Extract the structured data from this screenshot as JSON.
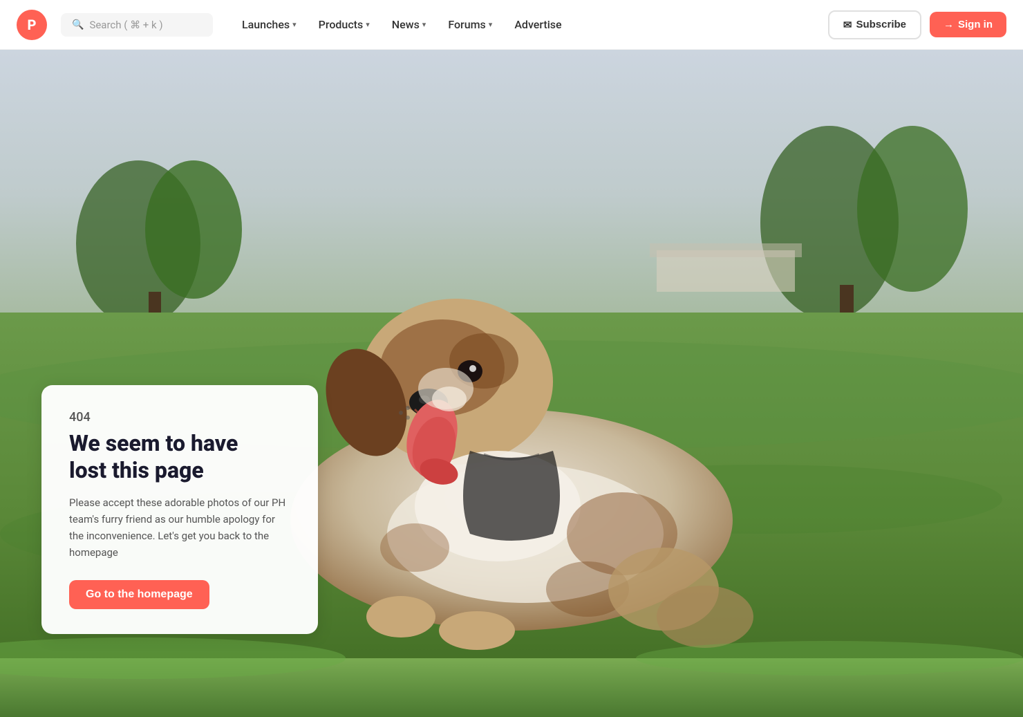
{
  "navbar": {
    "logo_letter": "P",
    "search_placeholder": "Search ( ⌘ + k )",
    "nav_items": [
      {
        "label": "Launches",
        "has_chevron": true
      },
      {
        "label": "Products",
        "has_chevron": true
      },
      {
        "label": "News",
        "has_chevron": true
      },
      {
        "label": "Forums",
        "has_chevron": true
      },
      {
        "label": "Advertise",
        "has_chevron": false
      }
    ],
    "subscribe_label": "Subscribe",
    "signin_label": "Sign in"
  },
  "error_page": {
    "error_code": "404",
    "title_line1": "We seem to have",
    "title_line2": "lost this page",
    "description": "Please accept these adorable photos of our PH team's furry friend as our humble apology for the inconvenience. Let's get you back to the homepage",
    "cta_button": "Go to the homepage"
  },
  "colors": {
    "accent": "#ff6154",
    "white": "#ffffff",
    "dark_text": "#1a1a2e",
    "muted_text": "#555555",
    "nav_bg": "#ffffff"
  }
}
